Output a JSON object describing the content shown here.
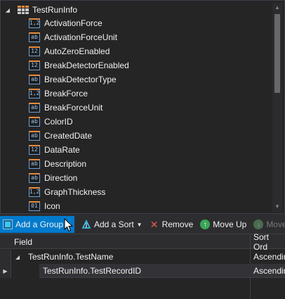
{
  "tree": {
    "root_label": "TestRunInfo",
    "fields": [
      {
        "label": "ActivationForce",
        "type": "1,2"
      },
      {
        "label": "ActivationForceUnit",
        "type": "ab"
      },
      {
        "label": "AutoZeroEnabled",
        "type": "12"
      },
      {
        "label": "BreakDetectorEnabled",
        "type": "12"
      },
      {
        "label": "BreakDetectorType",
        "type": "ab"
      },
      {
        "label": "BreakForce",
        "type": "1,2"
      },
      {
        "label": "BreakForceUnit",
        "type": "ab"
      },
      {
        "label": "ColorID",
        "type": "ab"
      },
      {
        "label": "CreatedDate",
        "type": "ab"
      },
      {
        "label": "DataRate",
        "type": "12"
      },
      {
        "label": "Description",
        "type": "ab"
      },
      {
        "label": "Direction",
        "type": "ab"
      },
      {
        "label": "GraphThickness",
        "type": "1,2"
      },
      {
        "label": "Icon",
        "type": "01"
      }
    ]
  },
  "toolbar": {
    "add_group_label": "Add a Group",
    "add_sort_label": "Add a Sort",
    "remove_label": "Remove",
    "move_up_label": "Move Up",
    "move_down_label": "Move"
  },
  "grid": {
    "col_field": "Field",
    "col_sort_order": "Sort Ord",
    "rows": [
      {
        "field": "TestRunInfo.TestName",
        "sort_order": "Ascendin"
      },
      {
        "field": "TestRunInfo.TestRecordID",
        "sort_order": "Ascendin"
      }
    ]
  },
  "colors": {
    "accent": "#007acc",
    "background": "#252526",
    "icon_orange": "#e98b3a",
    "icon_blue": "#6a9fd8"
  }
}
